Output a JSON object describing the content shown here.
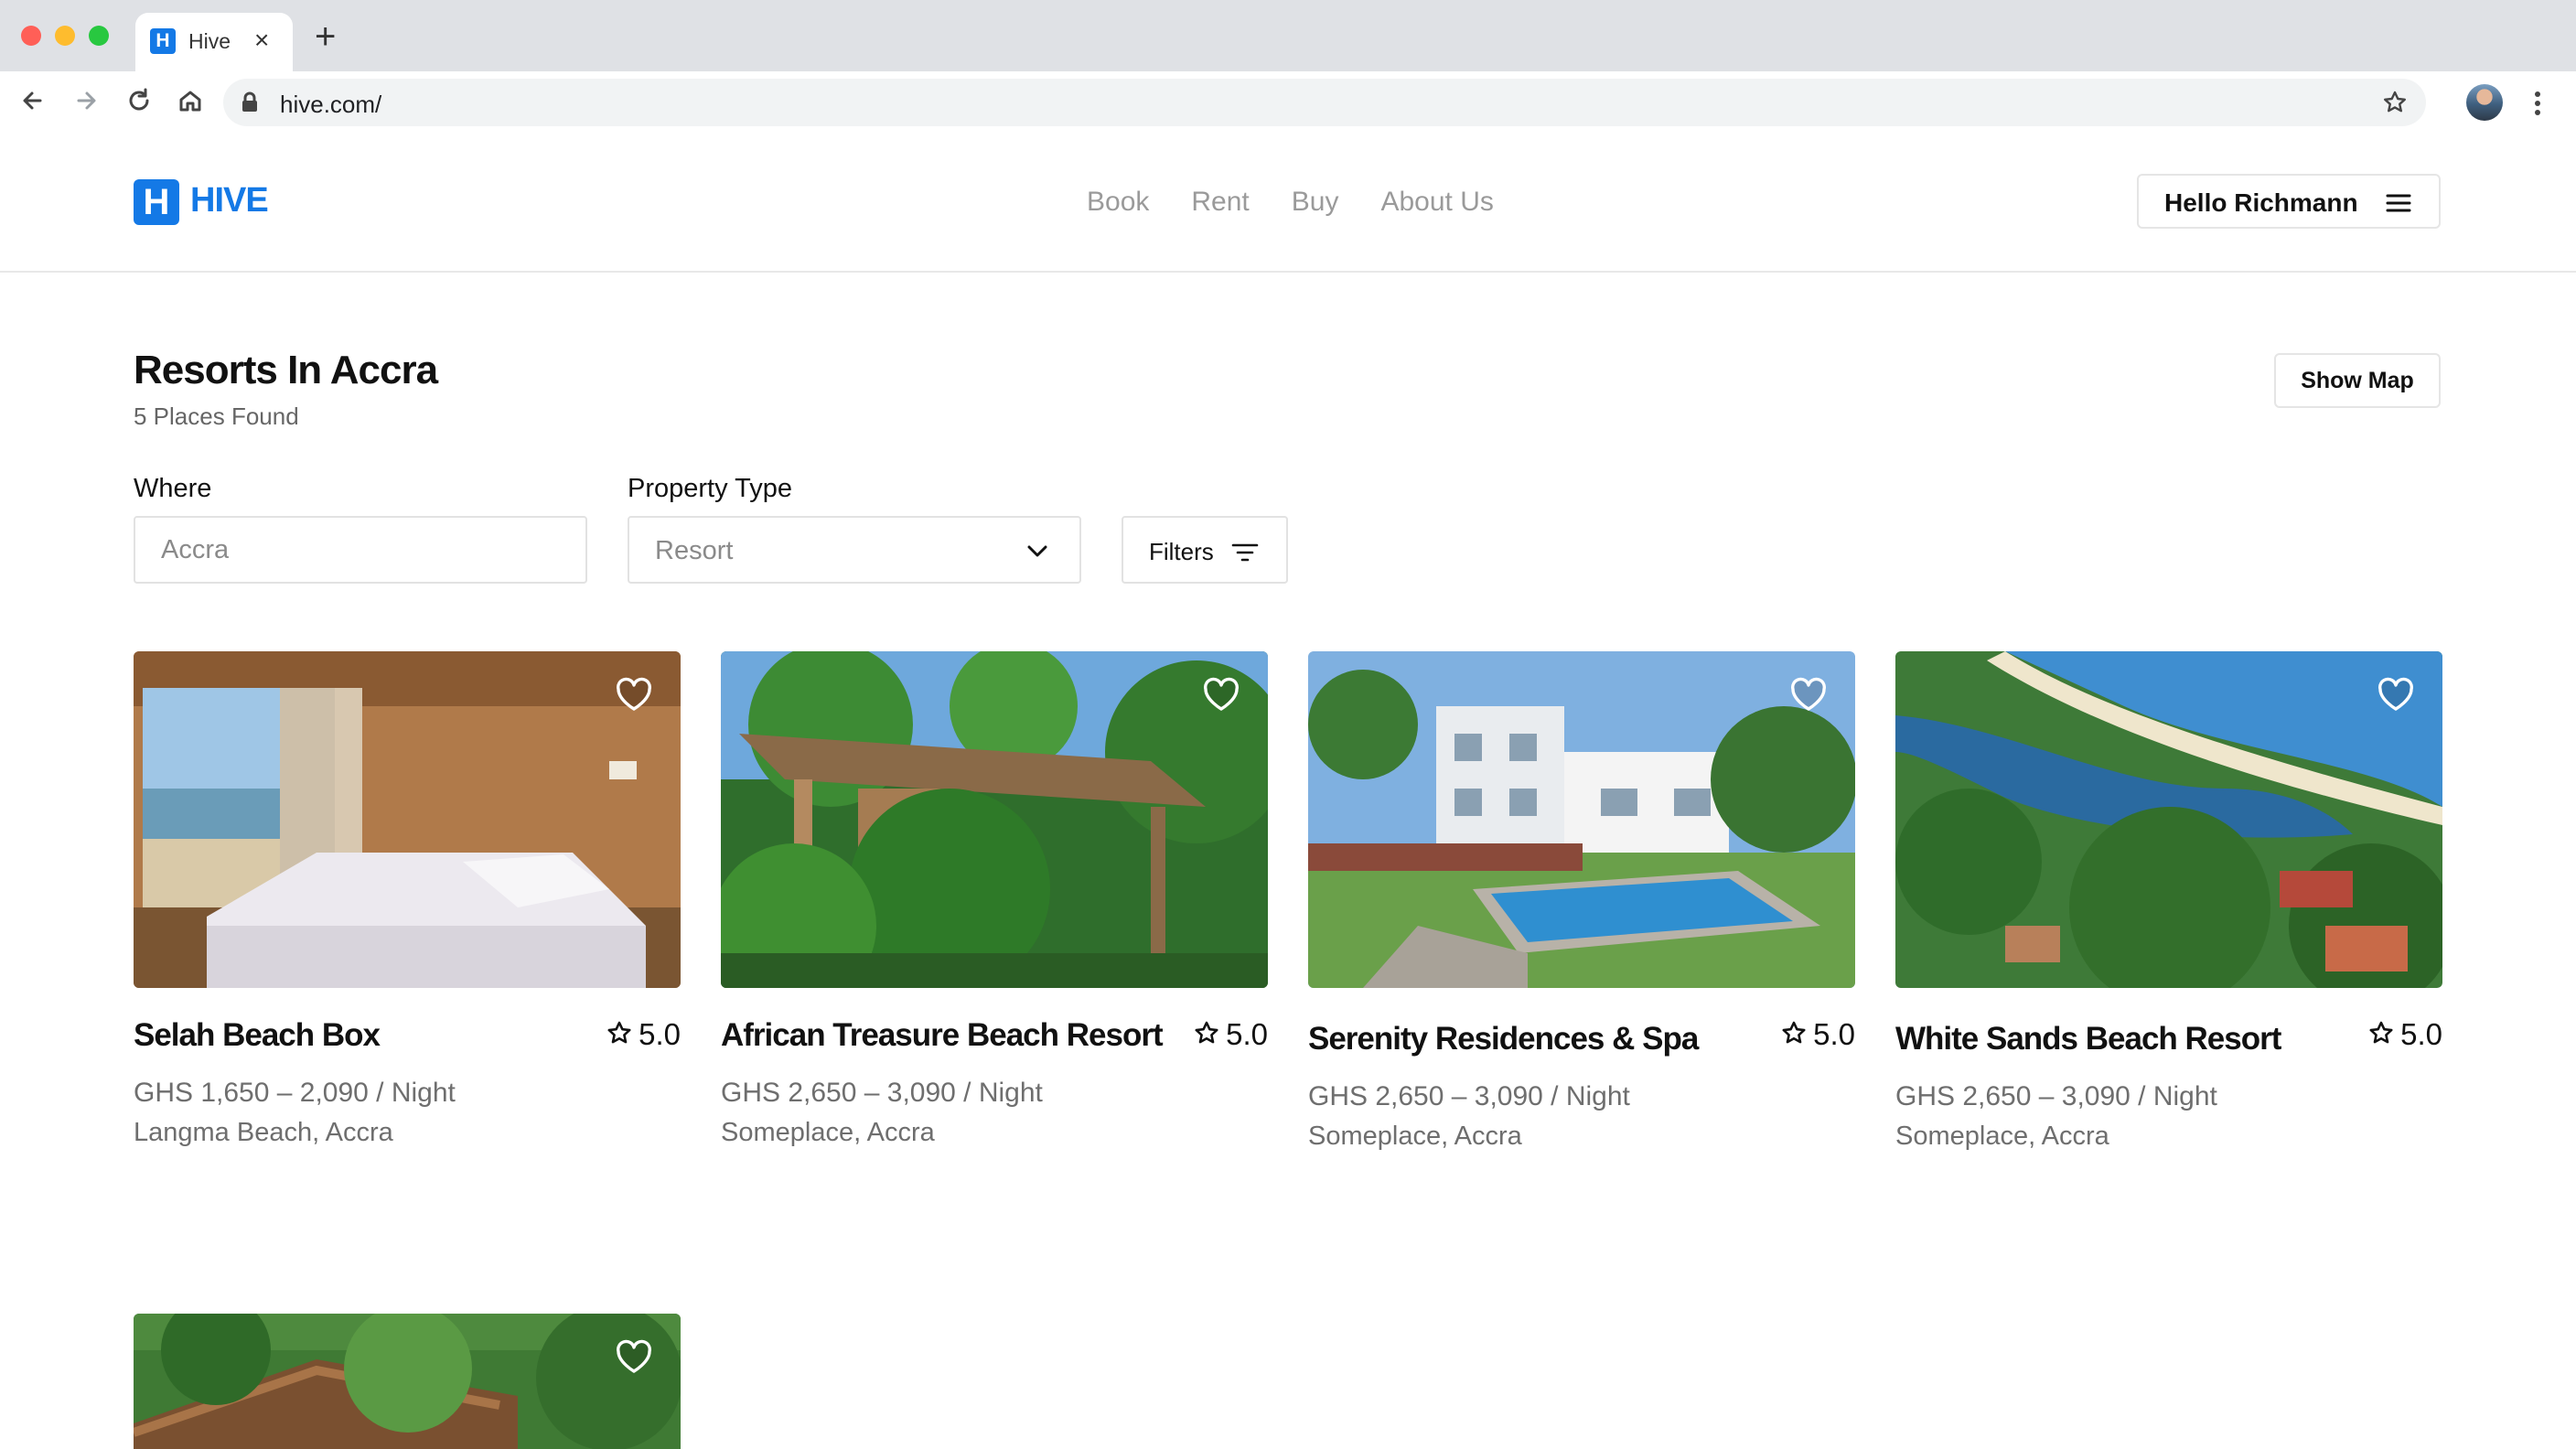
{
  "browser": {
    "tab_title": "Hive",
    "tab_favicon_letter": "H",
    "url": "hive.com/",
    "icons": [
      "back-icon",
      "forward-icon",
      "reload-icon",
      "home-icon",
      "lock-icon",
      "bookmark-star-icon",
      "profile-avatar",
      "kebab-menu-icon"
    ]
  },
  "header": {
    "logo_letter": "H",
    "logo_text": "HIVE",
    "nav": [
      {
        "label": "Book"
      },
      {
        "label": "Rent"
      },
      {
        "label": "Buy"
      },
      {
        "label": "About Us"
      }
    ],
    "user_button_label": "Hello Richmann"
  },
  "page": {
    "title": "Resorts In Accra",
    "subtitle": "5 Places Found",
    "show_map_label": "Show Map"
  },
  "filters": {
    "where_label": "Where",
    "where_placeholder": "Accra",
    "type_label": "Property Type",
    "type_value": "Resort",
    "filters_button_label": "Filters"
  },
  "colors": {
    "brand": "#1479e6",
    "muted_text": "#6e6e6e",
    "nav_text": "#9a9a9a"
  },
  "listings": [
    {
      "name": "Selah Beach Box",
      "rating": "5.0",
      "price": "GHS 1,650 – 2,090 / Night",
      "location": "Langma Beach, Accra"
    },
    {
      "name": "African Treasure Beach Resort",
      "rating": "5.0",
      "price": "GHS 2,650 – 3,090 / Night",
      "location": "Someplace, Accra"
    },
    {
      "name": "Serenity Residences & Spa",
      "rating": "5.0",
      "price": "GHS 2,650 – 3,090 / Night",
      "location": "Someplace, Accra"
    },
    {
      "name": "White Sands Beach Resort",
      "rating": "5.0",
      "price": "GHS 2,650 – 3,090 / Night",
      "location": "Someplace, Accra"
    }
  ]
}
